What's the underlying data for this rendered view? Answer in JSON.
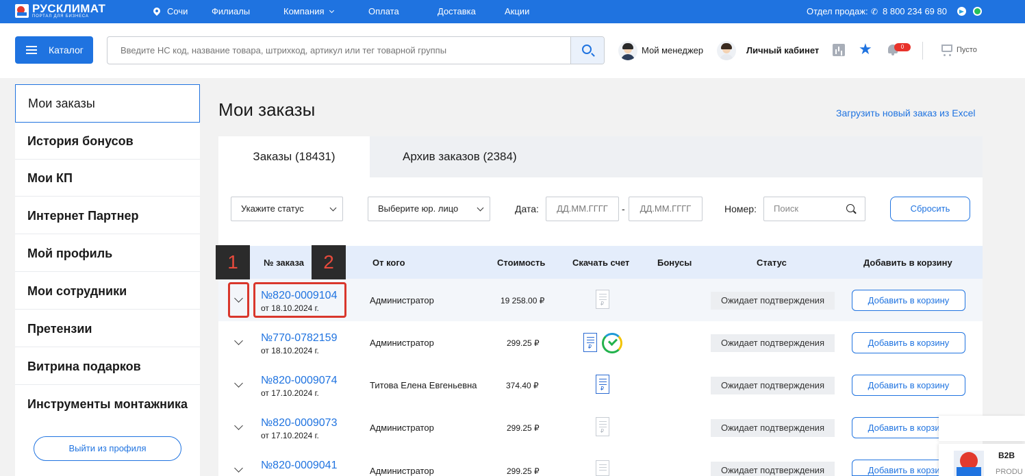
{
  "topbar": {
    "logo_text": "РУСКЛИМАТ",
    "logo_sub": "ПОРТАЛ ДЛЯ БИЗНЕСА",
    "city": "Сочи",
    "nav": [
      "Филиалы",
      "Компания",
      "Оплата",
      "Доставка",
      "Акции"
    ],
    "sales_label": "Отдел продаж:",
    "phone": "8 800 234 69 80"
  },
  "header": {
    "catalog_label": "Каталог",
    "search_placeholder": "Введите НС код, название товара, штрихкод, артикул или тег товарной группы",
    "manager_label": "Мой менеджер",
    "cabinet_label": "Личный кабинет",
    "notifications_count": "0",
    "cart_label": "Пусто"
  },
  "sidebar": {
    "items": [
      "Мои заказы",
      "История бонусов",
      "Мои КП",
      "Интернет Партнер",
      "Мой профиль",
      "Мои сотрудники",
      "Претензии",
      "Витрина подарков",
      "Инструменты монтажника"
    ],
    "active_index": 0,
    "logout_label": "Выйти из профиля"
  },
  "main": {
    "title": "Мои заказы",
    "upload_link": "Загрузить новый заказ из Excel",
    "tabs": [
      "Заказы (18431)",
      "Архив заказов (2384)"
    ],
    "filters": {
      "status_placeholder": "Укажите статус",
      "legal_placeholder": "Выберите юр. лицо",
      "date_label": "Дата:",
      "date_from_placeholder": "ДД.ММ.ГГГГ",
      "date_dash": "-",
      "date_to_placeholder": "ДД.ММ.ГГГГ",
      "number_label": "Номер:",
      "number_placeholder": "Поиск",
      "reset_label": "Сбросить"
    },
    "table": {
      "headers": [
        "№ заказа",
        "От кого",
        "Стоимость",
        "Скачать счет",
        "Бонусы",
        "Статус",
        "Добавить в корзину"
      ],
      "rows": [
        {
          "number": "№820-0009104",
          "date": "от 18.10.2024 г.",
          "from": "Администратор",
          "cost": "19 258.00 ₽",
          "invoice": "gray",
          "status": "Ожидает подтверждения",
          "action": "Добавить в корзину"
        },
        {
          "number": "№770-0782159",
          "date": "от 18.10.2024 г.",
          "from": "Администратор",
          "cost": "299.25 ₽",
          "invoice": "blue-sber",
          "status": "Ожидает подтверждения",
          "action": "Добавить в корзину"
        },
        {
          "number": "№820-0009074",
          "date": "от 17.10.2024 г.",
          "from": "Титова Елена Евгеньевна",
          "cost": "374.40 ₽",
          "invoice": "blue",
          "status": "Ожидает подтверждения",
          "action": "Добавить в корзину"
        },
        {
          "number": "№820-0009073",
          "date": "от 17.10.2024 г.",
          "from": "Администратор",
          "cost": "299.25 ₽",
          "invoice": "gray",
          "status": "Ожидает подтверждения",
          "action": "Добавить в корзину"
        },
        {
          "number": "№820-0009041",
          "date": "",
          "from": "Администратор",
          "cost": "299.25 ₽",
          "invoice": "gray",
          "status": "Ожидает подтверждения",
          "action": "Добавить в корзину"
        }
      ]
    }
  },
  "annotations": [
    "1",
    "2"
  ],
  "widget": {
    "label": "B2B",
    "sub": "PRODU"
  },
  "colors": {
    "brand": "#1f73e0",
    "annotation": "#d9372c",
    "badge": "#e8332b"
  }
}
